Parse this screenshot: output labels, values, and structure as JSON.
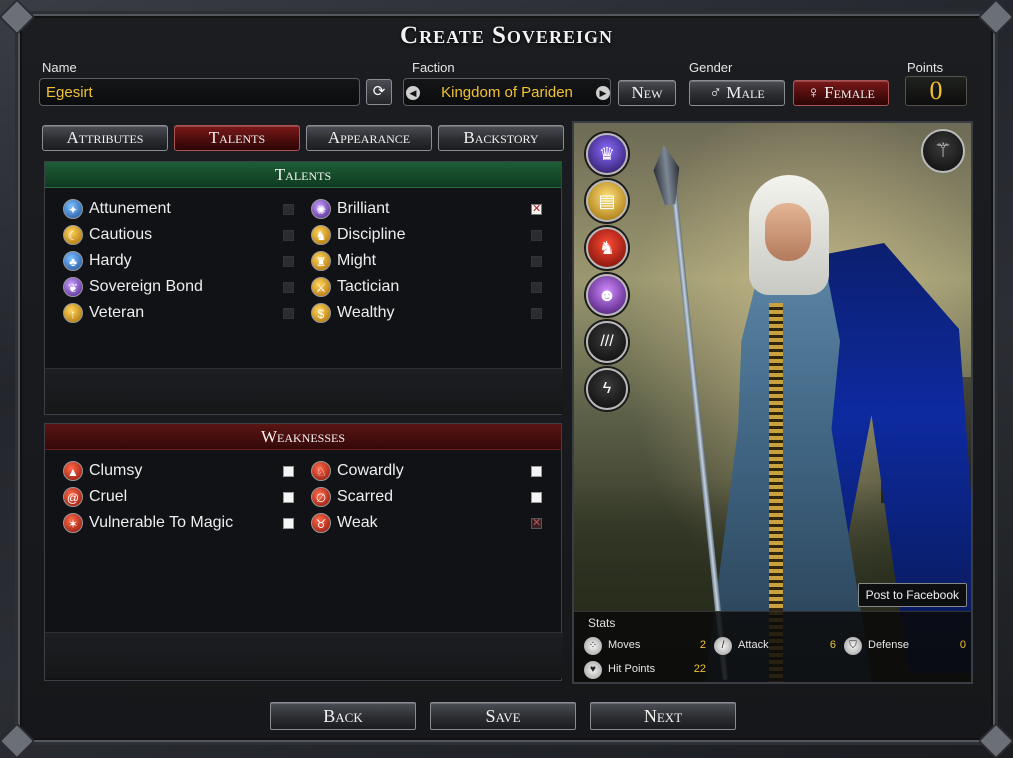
{
  "window": {
    "title": "Create Sovereign"
  },
  "name_field": {
    "label": "Name",
    "value": "Egesirt"
  },
  "faction": {
    "label": "Faction",
    "value": "Kingdom of Pariden",
    "new_label": "New"
  },
  "gender": {
    "label": "Gender",
    "male_label": "Male",
    "female_label": "Female",
    "selected": "Female"
  },
  "points": {
    "label": "Points",
    "value": "0"
  },
  "tabs": [
    {
      "label": "Attributes",
      "active": false
    },
    {
      "label": "Talents",
      "active": true
    },
    {
      "label": "Appearance",
      "active": false
    },
    {
      "label": "Backstory",
      "active": false
    }
  ],
  "talents": {
    "title": "Talents",
    "left": [
      {
        "label": "Attunement",
        "icon": "attunement-icon",
        "checked": false
      },
      {
        "label": "Cautious",
        "icon": "cautious-icon",
        "checked": false
      },
      {
        "label": "Hardy",
        "icon": "hardy-icon",
        "checked": false
      },
      {
        "label": "Sovereign Bond",
        "icon": "sovereign-bond-icon",
        "checked": false
      },
      {
        "label": "Veteran",
        "icon": "veteran-icon",
        "checked": false
      }
    ],
    "right": [
      {
        "label": "Brilliant",
        "icon": "brilliant-icon",
        "checked": true
      },
      {
        "label": "Discipline",
        "icon": "discipline-icon",
        "checked": false
      },
      {
        "label": "Might",
        "icon": "might-icon",
        "checked": false
      },
      {
        "label": "Tactician",
        "icon": "tactician-icon",
        "checked": false
      },
      {
        "label": "Wealthy",
        "icon": "wealthy-icon",
        "checked": false
      }
    ]
  },
  "weaknesses": {
    "title": "Weaknesses",
    "left": [
      {
        "label": "Clumsy",
        "icon": "clumsy-icon",
        "checked": false
      },
      {
        "label": "Cruel",
        "icon": "cruel-icon",
        "checked": false
      },
      {
        "label": "Vulnerable To Magic",
        "icon": "vulnerable-to-magic-icon",
        "checked": false
      }
    ],
    "right": [
      {
        "label": "Cowardly",
        "icon": "cowardly-icon",
        "checked": false
      },
      {
        "label": "Scarred",
        "icon": "scarred-icon",
        "checked": false
      },
      {
        "label": "Weak",
        "icon": "weak-icon",
        "checked": true,
        "disabled": true
      }
    ]
  },
  "portrait": {
    "side_icons": [
      "crown-icon",
      "book-icon",
      "beast-icon",
      "figure-aura-icon",
      "claw-rank-icon",
      "lightning-rank-icon"
    ],
    "equipment_icon": "staff-icon",
    "facebook_label": "Post to Facebook"
  },
  "stats": {
    "title": "Stats",
    "moves": {
      "label": "Moves",
      "value": "2",
      "icon": "boots-icon"
    },
    "attack": {
      "label": "Attack",
      "value": "6",
      "icon": "sword-icon"
    },
    "defense": {
      "label": "Defense",
      "value": "0",
      "icon": "shield-icon"
    },
    "hit_points": {
      "label": "Hit Points",
      "value": "22",
      "icon": "heart-icon"
    }
  },
  "footer": {
    "back_label": "Back",
    "save_label": "Save",
    "next_label": "Next"
  },
  "colors": {
    "accent_gold": "#f1c232",
    "talent_header": "#1d5d35",
    "weakness_header": "#5a1414",
    "active_tab": "#7b1818"
  }
}
